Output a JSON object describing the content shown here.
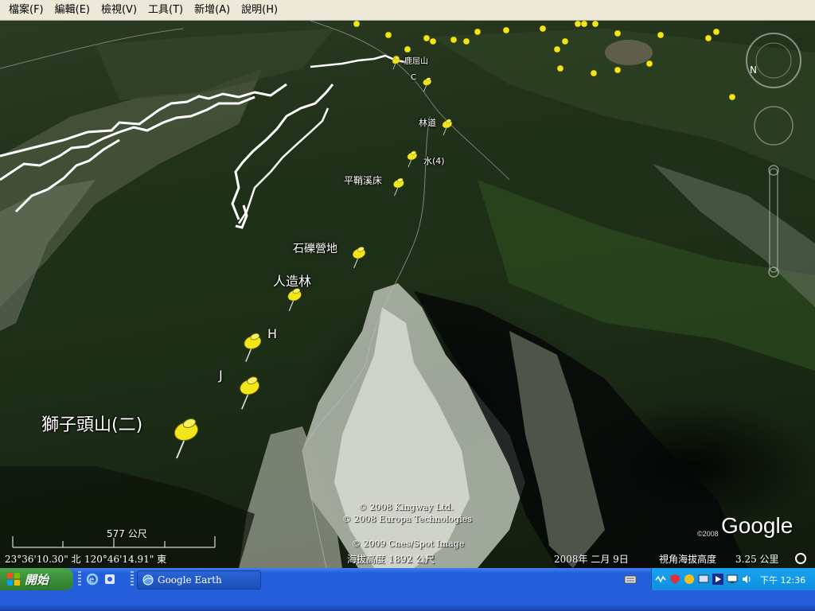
{
  "menu": {
    "items": [
      {
        "label": "檔案(F)"
      },
      {
        "label": "編輯(E)"
      },
      {
        "label": "檢視(V)"
      },
      {
        "label": "工具(T)"
      },
      {
        "label": "新增(A)"
      },
      {
        "label": "說明(H)"
      }
    ]
  },
  "map": {
    "placemarks": {
      "p1": "獅子頭山(二)",
      "p2": "J",
      "p3": "H",
      "p4": "人造林",
      "p5": "石礫營地",
      "p6": "平鞘溪床",
      "p7": "水(4)",
      "p8": "林道",
      "p9": "C",
      "p10": "鹿屈山"
    },
    "scale_label": "577 公尺",
    "copyright": {
      "line1": "© 2008 Kingway Ltd.",
      "line2": "© 2008 Europa Technologies",
      "line3": "© 2009 Cnes/Spot Image",
      "year": "©2008"
    },
    "logo": "Google",
    "status": {
      "latitude": "23°36'10.30\" 北",
      "longitude": "120°46'14.91\" 東",
      "elevation": "海拔高度  1892 公尺",
      "date": "2008年 二月  9日",
      "eye_alt_label": "視角海拔高度",
      "eye_alt_value": "3.25 公里"
    }
  },
  "taskbar": {
    "start_label": "開始",
    "task_label": "Google Earth",
    "clock": "下午 12:36"
  },
  "colors": {
    "pin": "#f2e61a",
    "menubar": "#ece9d8",
    "taskbar": "#245edb",
    "start": "#3c8f39",
    "tray": "#0f8ee0"
  }
}
